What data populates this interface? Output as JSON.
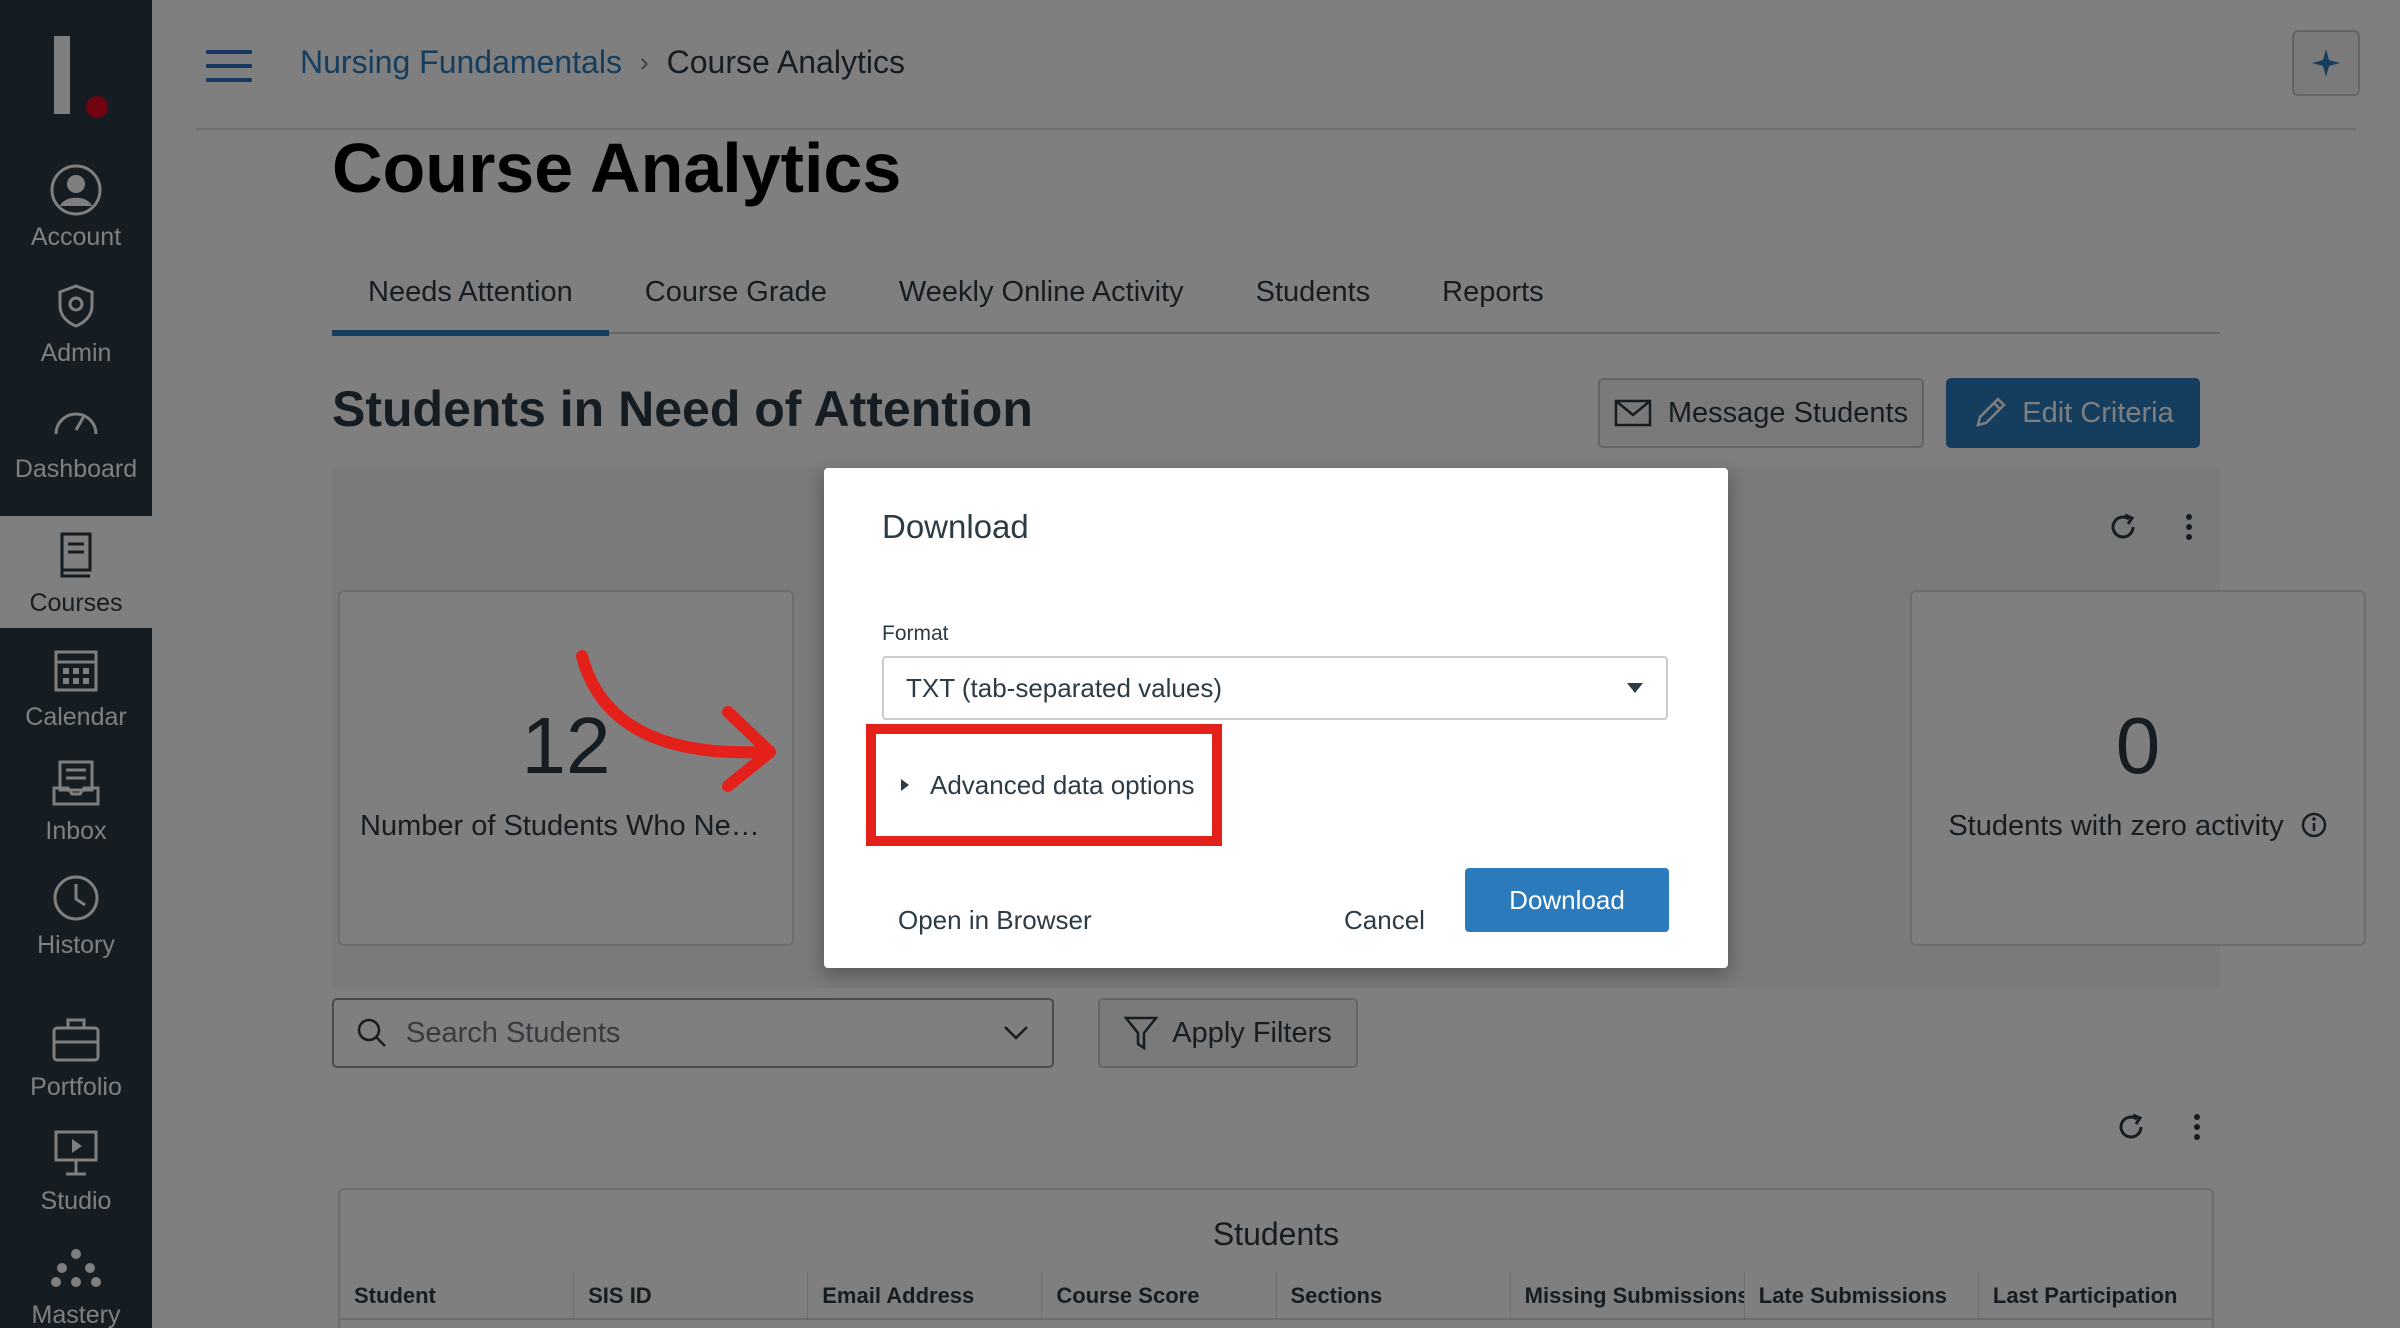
{
  "nav": {
    "items": [
      {
        "label": "Account",
        "icon": "account-icon"
      },
      {
        "label": "Admin",
        "icon": "admin-icon"
      },
      {
        "label": "Dashboard",
        "icon": "dashboard-icon"
      },
      {
        "label": "Courses",
        "icon": "courses-icon",
        "active": true
      },
      {
        "label": "Calendar",
        "icon": "calendar-icon"
      },
      {
        "label": "Inbox",
        "icon": "inbox-icon"
      },
      {
        "label": "History",
        "icon": "history-icon"
      },
      {
        "label": "Portfolio",
        "icon": "portfolio-icon"
      },
      {
        "label": "Studio",
        "icon": "studio-icon"
      },
      {
        "label": "Mastery",
        "icon": "mastery-icon"
      }
    ]
  },
  "breadcrumb": {
    "course": "Nursing Fundamentals",
    "separator": "›",
    "current": "Course Analytics"
  },
  "page": {
    "title": "Course Analytics"
  },
  "tabs": [
    {
      "label": "Needs Attention",
      "active": true
    },
    {
      "label": "Course Grade"
    },
    {
      "label": "Weekly Online Activity"
    },
    {
      "label": "Students"
    },
    {
      "label": "Reports"
    }
  ],
  "section": {
    "title": "Students in Need of Attention",
    "message_button": "Message Students",
    "edit_button": "Edit Criteria"
  },
  "cards": [
    {
      "value": "12",
      "label": "Number of Students Who Nee…"
    },
    {
      "value": "0",
      "label": "Students with zero activity"
    }
  ],
  "search": {
    "placeholder": "Search Students"
  },
  "filters": {
    "label": "Apply Filters"
  },
  "table": {
    "caption": "Students",
    "columns": [
      "Student",
      "SIS ID",
      "Email Address",
      "Course Score",
      "Sections",
      "Missing Submissions",
      "Late Submissions",
      "Last Participation"
    ]
  },
  "modal": {
    "title": "Download",
    "format_label": "Format",
    "format_value": "TXT (tab-separated values)",
    "advanced": "Advanced data options",
    "open_browser": "Open in Browser",
    "cancel": "Cancel",
    "download": "Download"
  },
  "colors": {
    "accent": "#2b7abc",
    "nav": "#2d3b45",
    "highlight": "#e4201b"
  }
}
